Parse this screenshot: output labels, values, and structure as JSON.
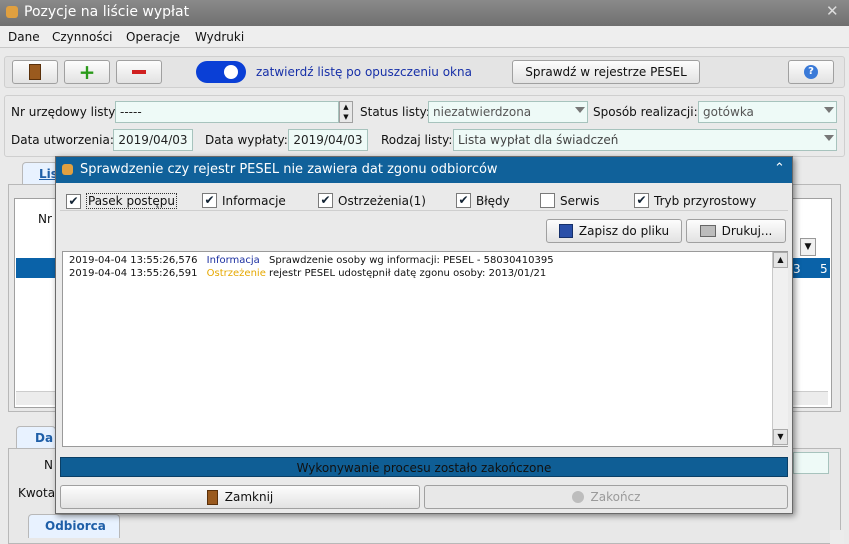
{
  "window": {
    "title": "Pozycje na liście wypłat"
  },
  "menu": {
    "items": [
      "Dane",
      "Czynności",
      "Operacje",
      "Wydruki"
    ]
  },
  "toolbar": {
    "toggle_label": "zatwierdź listę po opuszczeniu okna",
    "pesel_button": "Sprawdź w rejestrze PESEL"
  },
  "form": {
    "nr_label": "Nr urzędowy listy:",
    "nr_value": "-----",
    "status_label": "Status listy:",
    "status_value": "niezatwierdzona",
    "sposob_label": "Sposób realizacji:",
    "sposob_value": "gotówka",
    "data_utw_label": "Data utworzenia:",
    "data_utw_value": "2019/04/03",
    "data_wyp_label": "Data wypłaty:",
    "data_wyp_value": "2019/04/03",
    "rodzaj_label": "Rodzaj listy:",
    "rodzaj_value": "Lista wypłat dla świadczeń"
  },
  "background": {
    "tab_fragment": "Lis",
    "col_fragment": "Nr",
    "cell_a": "3",
    "cell_b": "5",
    "lower_tab_fragment": "Da",
    "label_n": "N",
    "label_kwota": "Kwota",
    "tab_odbiorca": "Odbiorca"
  },
  "dialog": {
    "title": "Sprawdzenie czy rejestr PESEL nie zawiera dat zgonu odbiorców",
    "checkboxes": [
      {
        "label": "Pasek postępu",
        "checked": true
      },
      {
        "label": "Informacje",
        "checked": true
      },
      {
        "label": "Ostrzeżenia(1)",
        "checked": true
      },
      {
        "label": "Błędy",
        "checked": true
      },
      {
        "label": "Serwis",
        "checked": false
      },
      {
        "label": "Tryb przyrostowy",
        "checked": true
      }
    ],
    "save_button": "Zapisz do pliku",
    "print_button": "Drukuj...",
    "log": [
      {
        "time": "2019-04-04 13:55:26,576",
        "type": "Informacja",
        "type_color": "#1a2ea0",
        "message": "Sprawdzenie osoby wg informacji: PESEL - 58030410395"
      },
      {
        "time": "2019-04-04 13:55:26,591",
        "type": "Ostrzeżenie",
        "type_color": "#e6a800",
        "message": "rejestr PESEL udostępnił datę zgonu osoby: 2013/01/21"
      }
    ],
    "progress_text": "Wykonywanie procesu zostało zakończone",
    "close_button": "Zamknij",
    "finish_button": "Zakończ"
  },
  "colors": {
    "accent": "#10619a",
    "toggle": "#0a3fd6"
  }
}
